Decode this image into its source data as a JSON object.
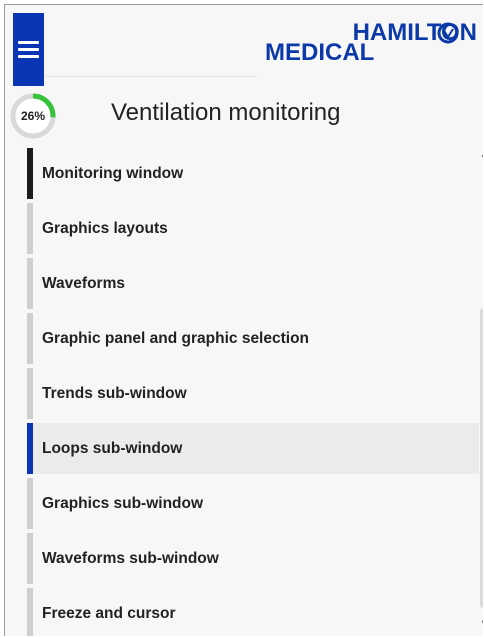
{
  "header": {
    "menu_icon": "hamburger-menu-icon",
    "brand_color": "#0a35b4",
    "logo_line1": "HAMILTON",
    "logo_line2": "MEDICAL"
  },
  "progress": {
    "label": "26%",
    "value": 0.26,
    "color": "#36c23a"
  },
  "page": {
    "title": "Ventilation monitoring"
  },
  "nav": {
    "items": [
      {
        "label": "Monitoring window",
        "state": "current"
      },
      {
        "label": "Graphics layouts",
        "state": ""
      },
      {
        "label": "Waveforms",
        "state": ""
      },
      {
        "label": "Graphic panel and graphic selection",
        "state": ""
      },
      {
        "label": "Trends sub-window",
        "state": ""
      },
      {
        "label": "Loops sub-window",
        "state": "active"
      },
      {
        "label": "Graphics sub-window",
        "state": ""
      },
      {
        "label": "Waveforms sub-window",
        "state": ""
      },
      {
        "label": "Freeze and cursor",
        "state": ""
      }
    ]
  },
  "scrollbar": {
    "up_icon": "scroll-up-arrow-icon",
    "down_icon": "scroll-down-arrow-icon"
  }
}
